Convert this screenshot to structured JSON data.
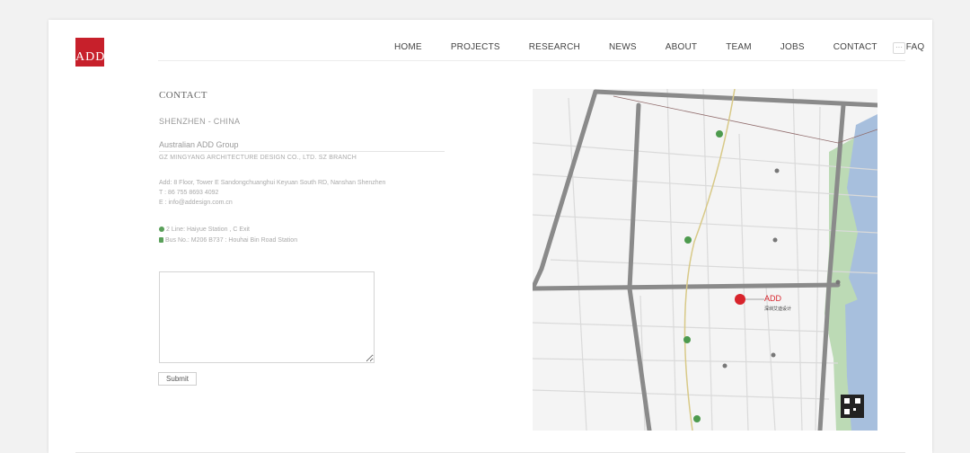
{
  "header": {
    "logo_text": "ADD",
    "nav": [
      "HOME",
      "PROJECTS",
      "RESEARCH",
      "NEWS",
      "ABOUT",
      "TEAM",
      "JOBS",
      "CONTACT",
      "FAQ"
    ],
    "more_label": "···"
  },
  "contact": {
    "title": "CONTACT",
    "city": "SHENZHEN - CHINA",
    "company": "Australian ADD Group",
    "firm": "GZ MINGYANG ARCHITECTURE DESIGN CO., LTD. SZ BRANCH",
    "address": "Add: 8 Floor, Tower E Sandongchuanghui Keyuan South RD, Nanshan Shenzhen",
    "phone": "T : 86 755 8693 4092",
    "email": "E : info@addesign.com.cn",
    "metro": "2 Line: Haiyue Station , C Exit",
    "bus": "Bus No.: M206 B737 : Houhai Bin Road Station"
  },
  "form": {
    "message_placeholder": "",
    "submit_label": "Submit"
  },
  "map": {
    "marker_label": "ADD",
    "marker_sub": "深圳艾迪设计",
    "colors": {
      "road": "#8a8a8a",
      "water": "#9cb6d6",
      "park": "#b9d8b3",
      "marker": "#d8242c",
      "metro": "#4d9a4d"
    }
  }
}
